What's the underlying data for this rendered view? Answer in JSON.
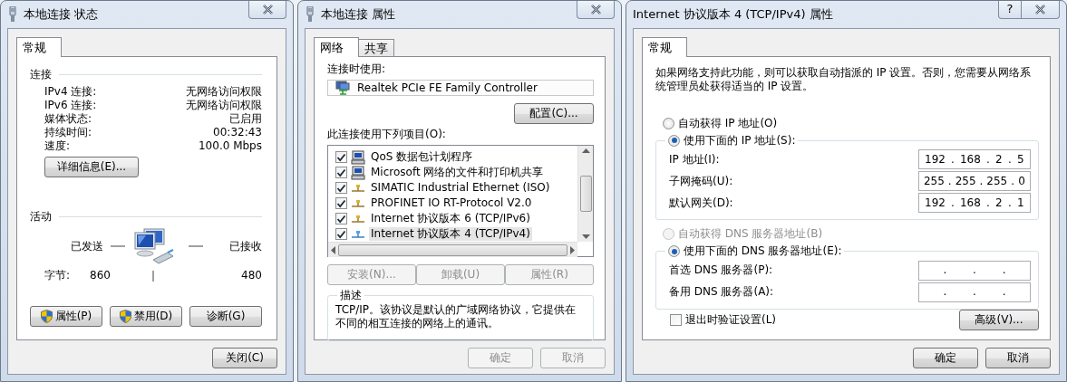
{
  "status_dialog": {
    "title": "本地连接 状态",
    "tabs": [
      {
        "label": "常规",
        "selected": true
      }
    ],
    "connection_heading": "连接",
    "rows": [
      {
        "label": "IPv4 连接:",
        "value": "无网络访问权限"
      },
      {
        "label": "IPv6 连接:",
        "value": "无网络访问权限"
      },
      {
        "label": "媒体状态:",
        "value": "已启用"
      },
      {
        "label": "持续时间:",
        "value": "00:32:43"
      },
      {
        "label": "速度:",
        "value": "100.0 Mbps"
      }
    ],
    "details_button": "详细信息(E)...",
    "activity_heading": "活动",
    "sent_label": "已发送",
    "received_label": "已接收",
    "bytes_label": "字节:",
    "bytes_sent": "860",
    "bytes_received": "480",
    "buttons": [
      {
        "label": "属性(P)",
        "shield": true
      },
      {
        "label": "禁用(D)",
        "shield": true
      },
      {
        "label": "诊断(G)",
        "shield": false
      }
    ],
    "close_button": "关闭(C)"
  },
  "properties_dialog": {
    "title": "本地连接 属性",
    "tabs": [
      {
        "label": "网络",
        "selected": true
      },
      {
        "label": "共享",
        "selected": false
      }
    ],
    "connect_using_label": "连接时使用:",
    "adapter": "Realtek PCIe FE Family Controller",
    "configure_button": "配置(C)...",
    "items_label": "此连接使用下列项目(O):",
    "items": [
      {
        "label": "QoS 数据包计划程序",
        "kind": "client",
        "checked": true,
        "selected": false
      },
      {
        "label": "Microsoft 网络的文件和打印机共享",
        "kind": "client",
        "checked": true,
        "selected": false
      },
      {
        "label": "SIMATIC Industrial Ethernet (ISO)",
        "kind": "protocol",
        "checked": true,
        "selected": false
      },
      {
        "label": "PROFINET IO RT-Protocol V2.0",
        "kind": "protocol",
        "checked": true,
        "selected": false
      },
      {
        "label": "Internet 协议版本 6 (TCP/IPv6)",
        "kind": "protocol",
        "checked": true,
        "selected": false
      },
      {
        "label": "Internet 协议版本 4 (TCP/IPv4)",
        "kind": "protocol",
        "checked": true,
        "selected": true
      }
    ],
    "item_buttons": [
      {
        "label": "安装(N)...",
        "disabled": true
      },
      {
        "label": "卸载(U)",
        "disabled": true
      },
      {
        "label": "属性(R)",
        "disabled": true
      }
    ],
    "description_heading": "描述",
    "description": "TCP/IP。该协议是默认的广域网络协议，它提供在不同的相互连接的网络上的通讯。",
    "footer_buttons": [
      {
        "label": "确定",
        "disabled": true
      },
      {
        "label": "取消",
        "disabled": true
      }
    ]
  },
  "ipv4_dialog": {
    "title": "Internet 协议版本 4 (TCP/IPv4) 属性",
    "help_button": "?",
    "tabs": [
      {
        "label": "常规",
        "selected": true
      }
    ],
    "intro": "如果网络支持此功能，则可以获取自动指派的 IP 设置。否则，您需要从网络系统管理员处获得适当的 IP 设置。",
    "ip_options": [
      {
        "label": "自动获得 IP 地址(O)",
        "selected": false,
        "disabled": false
      },
      {
        "label": "使用下面的 IP 地址(S):",
        "selected": true,
        "disabled": false
      }
    ],
    "ip_fields": [
      {
        "label": "IP 地址(I):",
        "octets": [
          "192",
          "168",
          "2",
          "5"
        ],
        "separators": [
          ".",
          ".",
          "."
        ]
      },
      {
        "label": "子网掩码(U):",
        "octets": [
          "255",
          "255",
          "255",
          "0"
        ],
        "separators": [
          ".",
          ".",
          "."
        ]
      },
      {
        "label": "默认网关(D):",
        "octets": [
          "192",
          "168",
          "2",
          "1"
        ],
        "separators": [
          ".",
          ".",
          "."
        ]
      }
    ],
    "dns_options": [
      {
        "label": "自动获得 DNS 服务器地址(B)",
        "selected": false,
        "disabled": true
      },
      {
        "label": "使用下面的 DNS 服务器地址(E):",
        "selected": true,
        "disabled": false
      }
    ],
    "dns_fields": [
      {
        "label": "首选 DNS 服务器(P):",
        "separators": [
          ".",
          ".",
          "."
        ]
      },
      {
        "label": "备用 DNS 服务器(A):",
        "separators": [
          ".",
          ".",
          "."
        ]
      }
    ],
    "validate_on_exit": {
      "label": "退出时验证设置(L)",
      "checked": false
    },
    "advanced_button": "高级(V)...",
    "footer_buttons": [
      "确定",
      "取消"
    ]
  }
}
